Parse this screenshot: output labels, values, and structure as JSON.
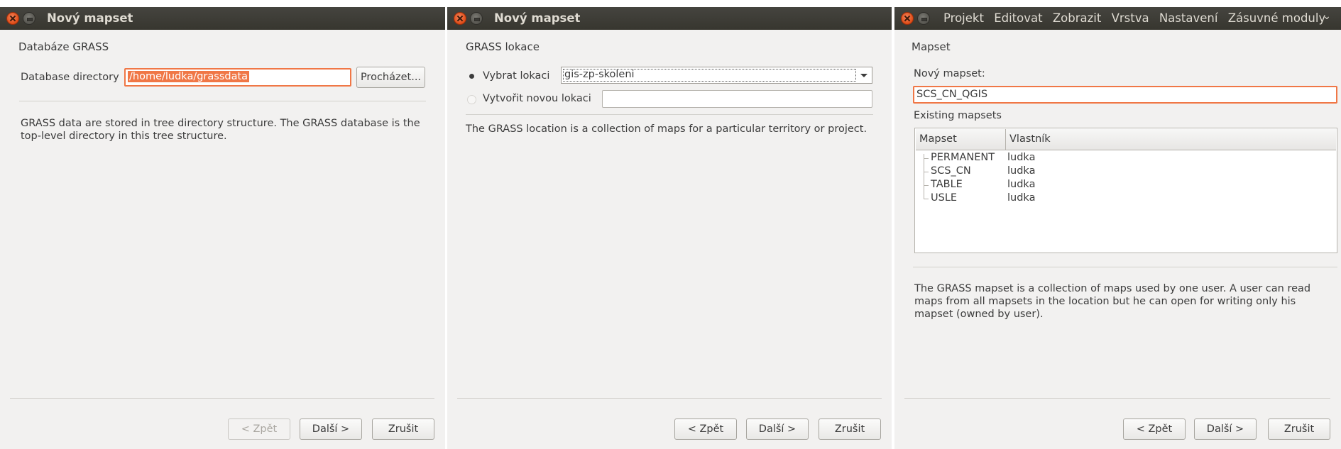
{
  "window1": {
    "title": "Nový mapset",
    "section": "Databáze GRASS",
    "dir_label": "Database directory",
    "dir_value": "/home/ludka/grassdata",
    "browse_button": "Procházet...",
    "description": "GRASS data are stored in tree directory structure. The GRASS database is the top-level directory in this tree structure.",
    "back": "< Zpět",
    "next": "Další >",
    "cancel": "Zrušit"
  },
  "window2": {
    "title": "Nový mapset",
    "section": "GRASS lokace",
    "select_label": "Vybrat lokaci",
    "select_value": "gis-zp-skoleni",
    "create_label": "Vytvořit novou lokaci",
    "create_value": "",
    "description": "The GRASS location is a collection of maps for a particular territory or project.",
    "back": "< Zpět",
    "next": "Další >",
    "cancel": "Zrušit"
  },
  "window3": {
    "menu": [
      "Projekt",
      "Editovat",
      "Zobrazit",
      "Vrstva",
      "Nastavení",
      "Zásuvné moduly"
    ],
    "section": "Mapset",
    "new_label": "Nový mapset:",
    "new_value": "SCS_CN_QGIS",
    "existing_label": "Existing mapsets",
    "columns": [
      "Mapset",
      "Vlastník"
    ],
    "rows": [
      {
        "mapset": "PERMANENT",
        "owner": "ludka"
      },
      {
        "mapset": "SCS_CN",
        "owner": "ludka"
      },
      {
        "mapset": "TABLE",
        "owner": "ludka"
      },
      {
        "mapset": "USLE",
        "owner": "ludka"
      }
    ],
    "description": "The GRASS mapset is a collection of maps used by one user. A user can read maps from all mapsets in the location but he can open for writing only his mapset (owned by user).",
    "back": "< Zpět",
    "next": "Další >",
    "cancel": "Zrušit"
  },
  "colors": {
    "titlebar": "#3b3a36",
    "dialog_bg": "#f2f1f0",
    "focus_accent": "#f07746"
  }
}
